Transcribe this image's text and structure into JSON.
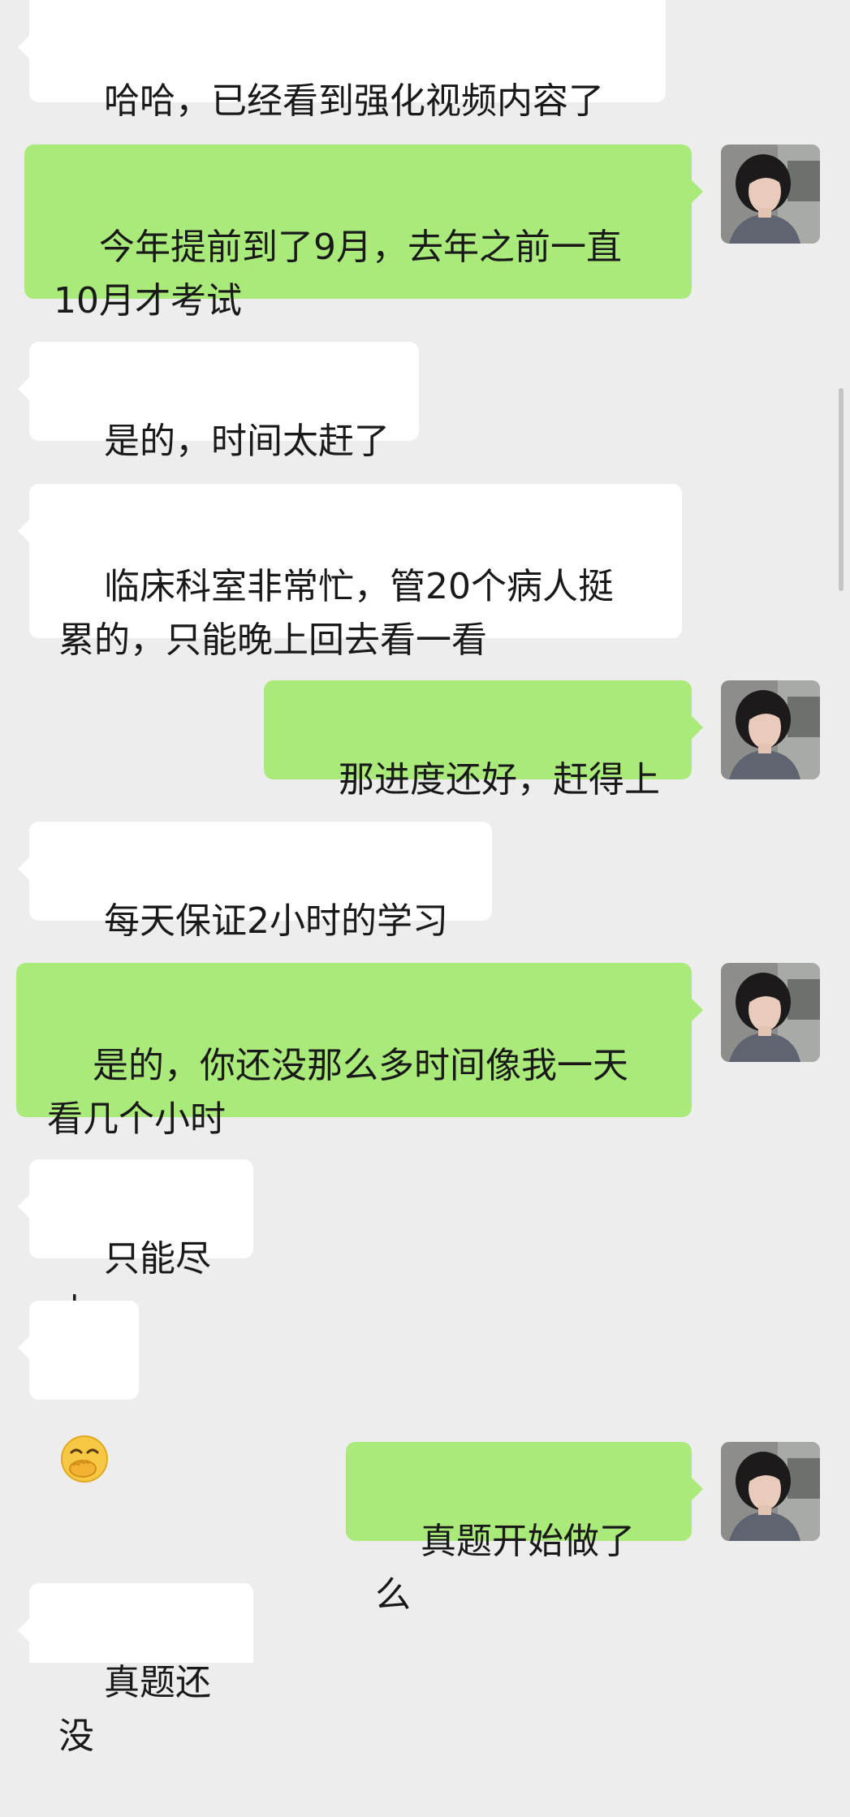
{
  "messages": [
    {
      "side": "in",
      "text": "哈哈，已经看到强化视频内容了"
    },
    {
      "side": "out",
      "text": "今年提前到了9月，去年之前一直\n10月才考试"
    },
    {
      "side": "in",
      "text": "是的，时间太赶了"
    },
    {
      "side": "in",
      "text": "临床科室非常忙，管20个病人挺\n累的，只能晚上回去看一看"
    },
    {
      "side": "out",
      "text": "那进度还好，赶得上"
    },
    {
      "side": "in",
      "text": "每天保证2小时的学习"
    },
    {
      "side": "out",
      "text": "是的，你还没那么多时间像我一天\n看几个小时"
    },
    {
      "side": "in",
      "text": "只能尽力"
    },
    {
      "side": "in",
      "emoji": "hand-over-mouth-face-emoji"
    },
    {
      "side": "out",
      "text": "真题开始做了么"
    },
    {
      "side": "in",
      "text": "真题还没"
    }
  ],
  "colors": {
    "background": "#ededed",
    "incoming_bubble": "#ffffff",
    "outgoing_bubble": "#a9ea7a",
    "text": "#191919"
  }
}
